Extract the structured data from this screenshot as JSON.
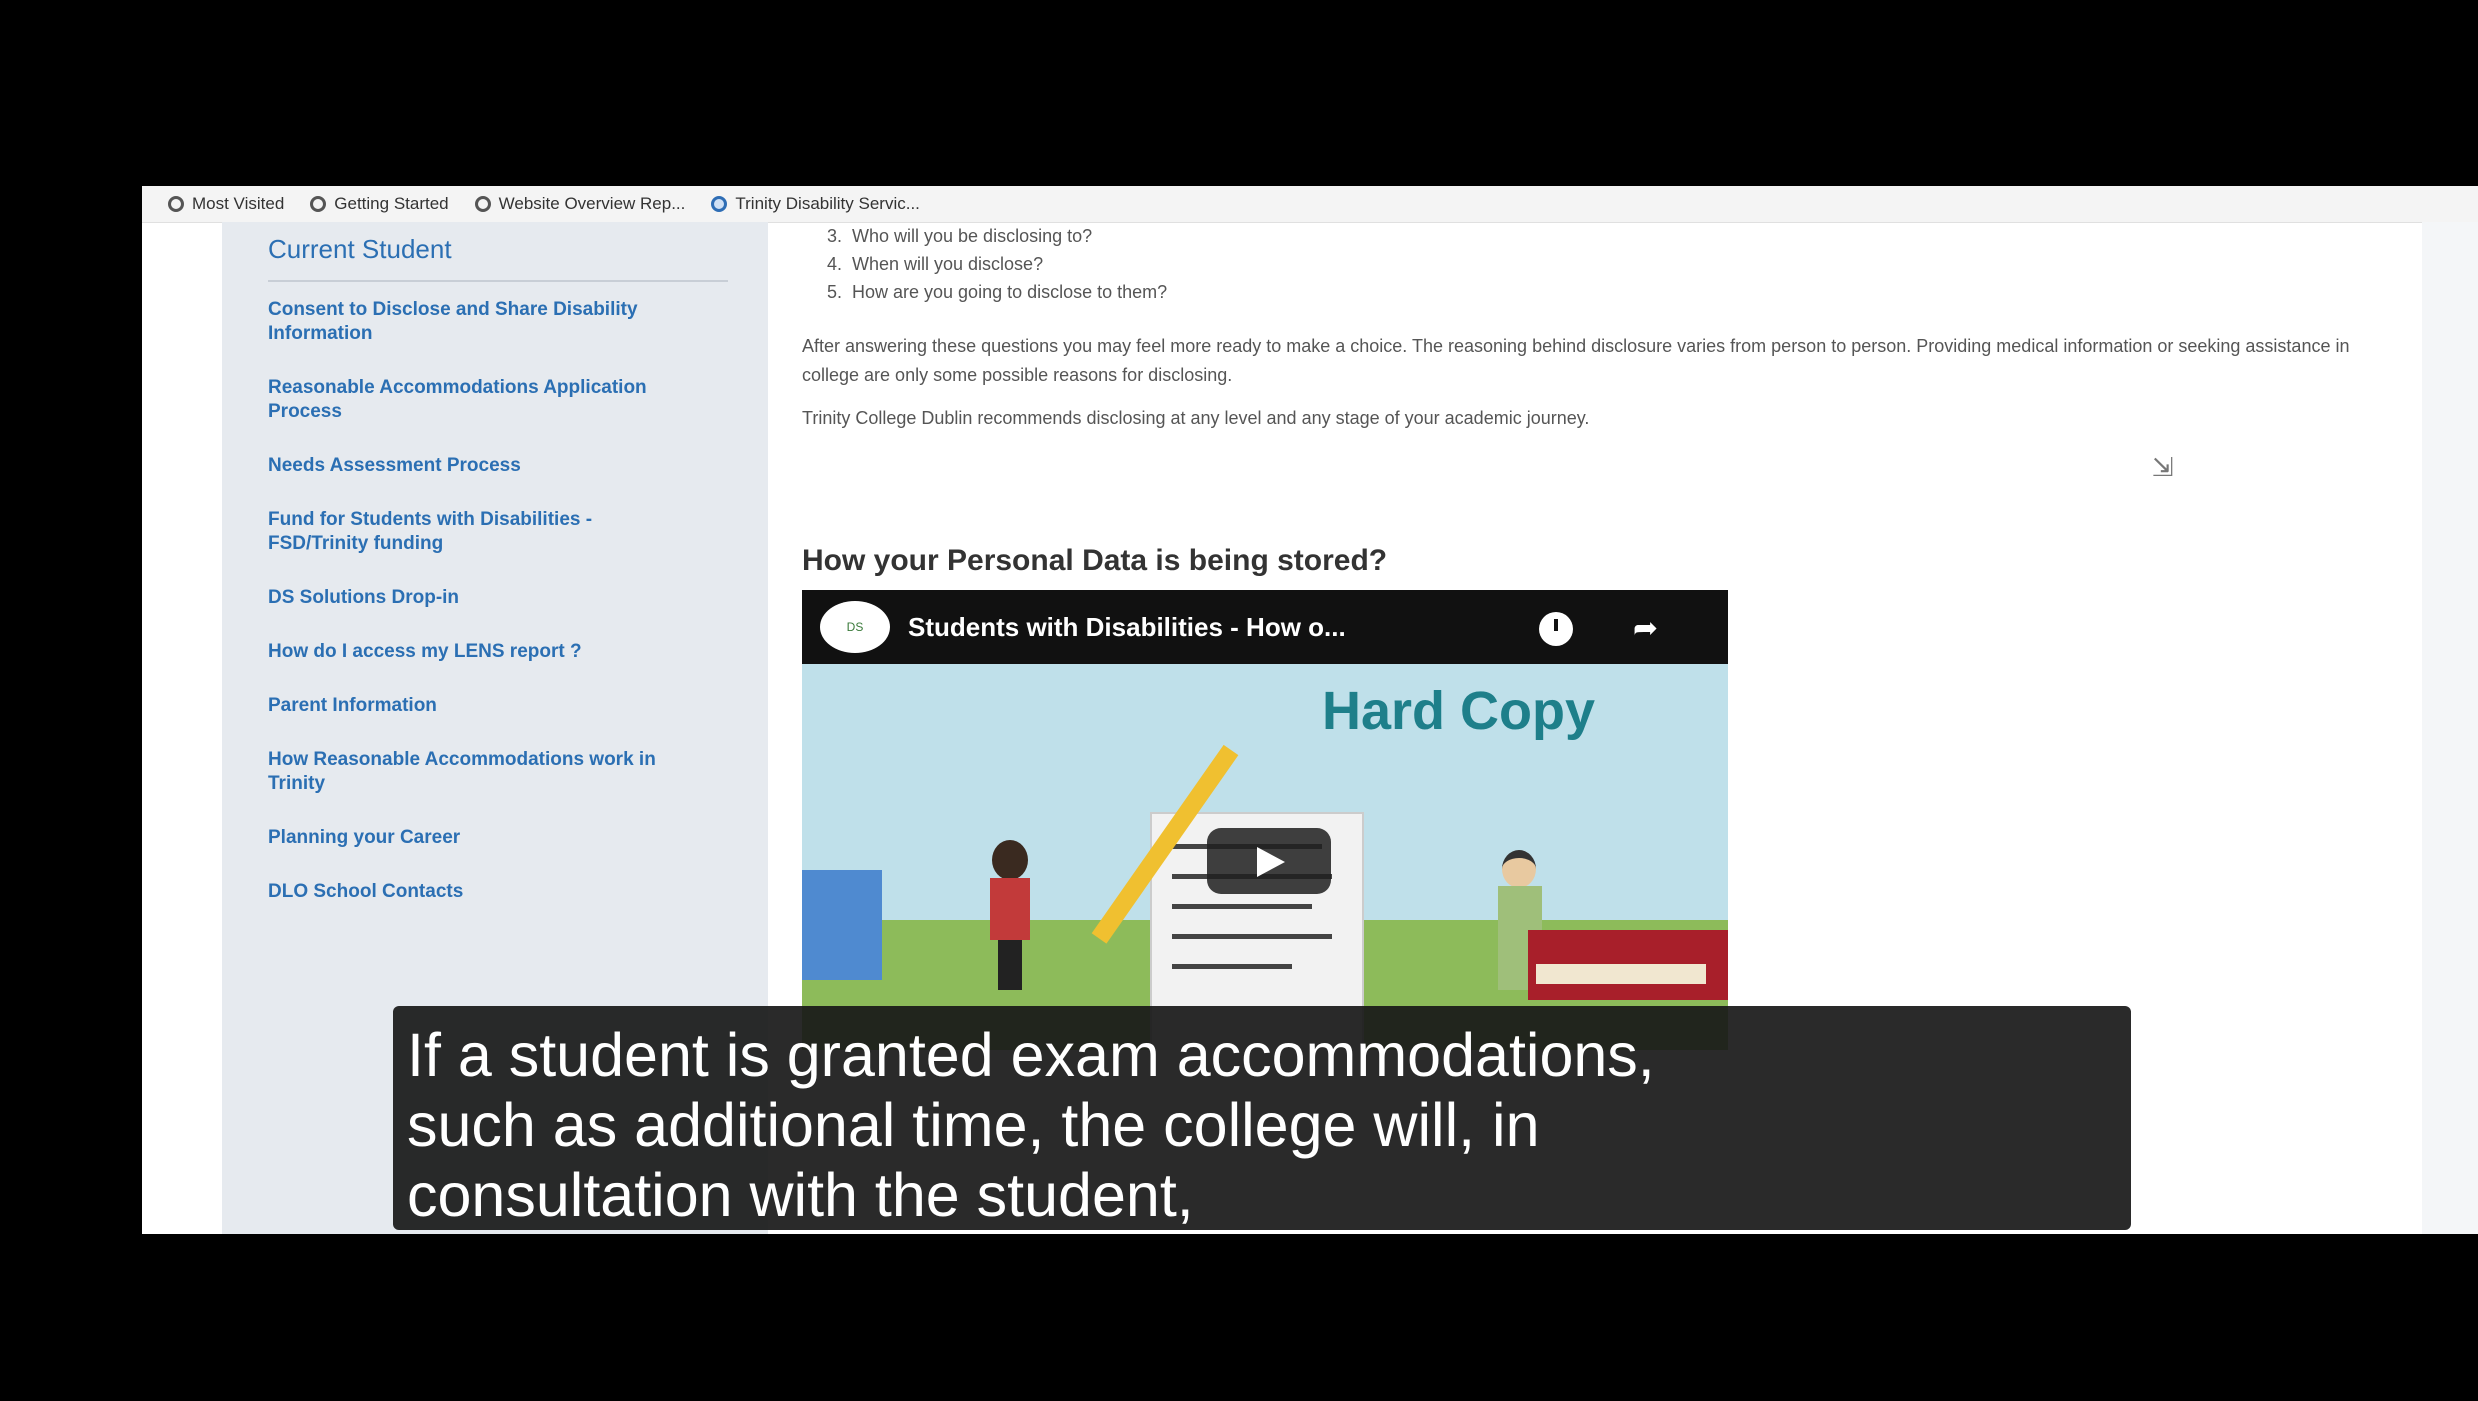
{
  "bookmarks": [
    {
      "label": "Most Visited",
      "icon": "gear-icon"
    },
    {
      "label": "Getting Started",
      "icon": "firefox-icon"
    },
    {
      "label": "Website Overview Rep...",
      "icon": "globe-icon"
    },
    {
      "label": "Trinity Disability Servic...",
      "icon": "tcd-shield-icon"
    }
  ],
  "sidebar": {
    "title": "Current Student",
    "items": [
      "Consent to Disclose and Share Disability Information",
      "Reasonable Accommodations Application Process",
      "Needs Assessment Process",
      "Fund for Students with Disabilities - FSD/Trinity funding",
      "DS Solutions Drop-in",
      "How do I access my LENS report ?",
      "Parent Information",
      "How Reasonable Accommodations work in Trinity",
      "Planning your Career",
      "DLO School Contacts"
    ]
  },
  "content": {
    "list": [
      {
        "num": "3.",
        "text": "Who will you be disclosing to?"
      },
      {
        "num": "4.",
        "text": "When will you disclose?"
      },
      {
        "num": "5.",
        "text": "How are you going to disclose to them?"
      }
    ],
    "para1": "After answering these questions you may feel more ready to make a choice. The reasoning behind disclosure varies from person to person. Providing medical information or seeking assistance in college are only some possible reasons for disclosing.",
    "para2": "Trinity College Dublin recommends disclosing at any level and any stage of your academic journey.",
    "heading": "How your Personal Data is being stored?"
  },
  "video": {
    "title": "Students with Disabilities - How o...",
    "channel": "DS",
    "banner": "Hard Copy"
  },
  "subtitle": {
    "lines": [
      "If a student is granted exam accommodations,",
      "such as additional time, the college will, in",
      "consultation with the student,"
    ]
  }
}
